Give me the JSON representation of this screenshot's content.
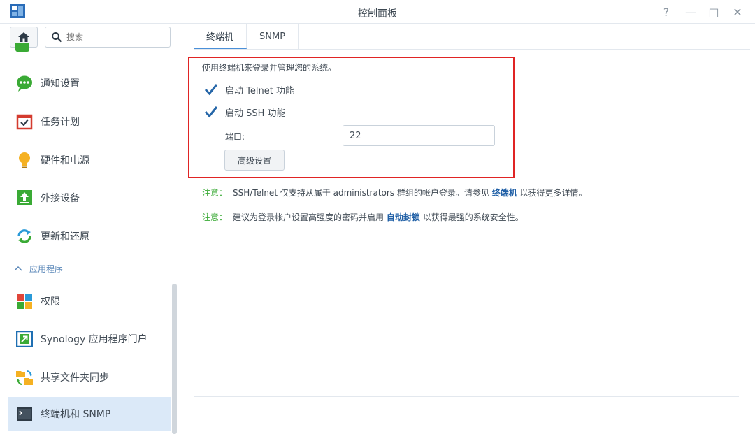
{
  "window": {
    "title": "控制面板",
    "help": "?",
    "minimize": "—",
    "maximize": "□",
    "close": "✕"
  },
  "sidebar": {
    "search_placeholder": "搜索",
    "items": [
      {
        "label": "通知设置",
        "icon": "chat-bubble-icon"
      },
      {
        "label": "任务计划",
        "icon": "calendar-icon"
      },
      {
        "label": "硬件和电源",
        "icon": "lightbulb-icon"
      },
      {
        "label": "外接设备",
        "icon": "upload-icon"
      },
      {
        "label": "更新和还原",
        "icon": "refresh-icon"
      }
    ],
    "section_label": "应用程序",
    "app_items": [
      {
        "label": "权限",
        "icon": "grid-icon"
      },
      {
        "label": "Synology 应用程序门户",
        "icon": "portal-arrow-icon"
      },
      {
        "label": "共享文件夹同步",
        "icon": "folder-sync-icon"
      },
      {
        "label": "终端机和 SNMP",
        "icon": "terminal-icon"
      }
    ],
    "selected": "终端机和 SNMP"
  },
  "main": {
    "tabs": [
      {
        "label": "终端机",
        "active": true
      },
      {
        "label": "SNMP",
        "active": false
      }
    ],
    "description": "使用终端机来登录并管理您的系统。",
    "telnet": {
      "label": "启动 Telnet 功能",
      "checked": true
    },
    "ssh": {
      "label": "启动 SSH 功能",
      "checked": true
    },
    "port_label": "端口:",
    "port_value": "22",
    "advanced_button": "高级设置",
    "note1": {
      "prefix": "注意：",
      "text": "SSH/Telnet 仅支持从属于 administrators 群组的帐户登录。请参见",
      "link": "终端机",
      "suffix": "以获得更多详情。"
    },
    "note2": {
      "prefix": "注意：",
      "text": "建议为登录帐户设置高强度的密码并启用",
      "link": "自动封锁",
      "suffix": "以获得最强的系统安全性。"
    }
  },
  "colors": {
    "accent": "#4a90d9",
    "highlight_border": "#e02424",
    "note_prefix": "#3aaa35",
    "link": "#1f5fa6",
    "selected_bg": "#dbe9f8"
  }
}
